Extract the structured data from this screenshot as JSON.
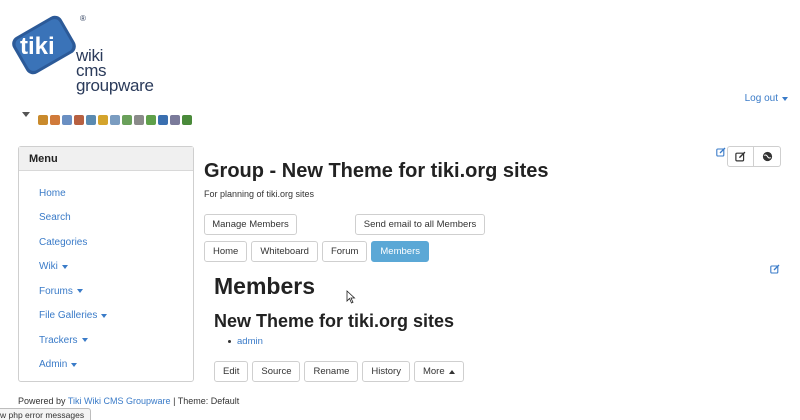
{
  "logo": {
    "badge_text": "tiki",
    "line1": "wiki",
    "line2": "cms",
    "line3": "groupware",
    "reg_mark": "®"
  },
  "header": {
    "logout_label": "Log out"
  },
  "toolbar_icons": [
    {
      "icon": "wrench-icon",
      "color": "#c98a2c"
    },
    {
      "icon": "home-icon",
      "color": "#d07a3a"
    },
    {
      "icon": "pencil-icon",
      "color": "#6a8fc2"
    },
    {
      "icon": "user-icon",
      "color": "#b76040"
    },
    {
      "icon": "users-icon",
      "color": "#5a8ab0"
    },
    {
      "icon": "key-icon",
      "color": "#d4a42c"
    },
    {
      "icon": "table-icon",
      "color": "#7a9cc0"
    },
    {
      "icon": "refresh-icon",
      "color": "#6aa05a"
    },
    {
      "icon": "module-icon",
      "color": "#8a8a8a"
    },
    {
      "icon": "puzzle-icon",
      "color": "#5fa04a"
    },
    {
      "icon": "book-icon",
      "color": "#3a6fb0"
    },
    {
      "icon": "card-icon",
      "color": "#7a7a9a"
    },
    {
      "icon": "leaf-icon",
      "color": "#4a8a3a"
    }
  ],
  "menu": {
    "heading": "Menu",
    "items": [
      {
        "label": "Home",
        "has_dropdown": false
      },
      {
        "label": "Search",
        "has_dropdown": false
      },
      {
        "label": "Categories",
        "has_dropdown": false
      },
      {
        "label": "Wiki",
        "has_dropdown": true
      },
      {
        "label": "Forums",
        "has_dropdown": true
      },
      {
        "label": "File Galleries",
        "has_dropdown": true
      },
      {
        "label": "Trackers",
        "has_dropdown": true
      },
      {
        "label": "Admin",
        "has_dropdown": true
      }
    ]
  },
  "main": {
    "title": "Group - New Theme for tiki.org sites",
    "description": "For planning of tiki.org sites",
    "manage_members_label": "Manage Members",
    "send_email_label": "Send email to all Members",
    "tabs": [
      {
        "label": "Home",
        "active": false
      },
      {
        "label": "Whiteboard",
        "active": false
      },
      {
        "label": "Forum",
        "active": false
      },
      {
        "label": "Members",
        "active": true
      }
    ],
    "members_heading": "Members",
    "group_heading": "New Theme for tiki.org sites",
    "members": [
      "admin"
    ],
    "actions": [
      {
        "label": "Edit"
      },
      {
        "label": "Source"
      },
      {
        "label": "Rename"
      },
      {
        "label": "History"
      },
      {
        "label": "More"
      }
    ]
  },
  "footer": {
    "powered_by": "Powered by",
    "link_text": "Tiki Wiki CMS Groupware",
    "theme_text": "| Theme: Default"
  },
  "status": {
    "text": "w php error messages"
  },
  "colors": {
    "accent": "#3a7bc8",
    "active_tab": "#5ba8d6",
    "logo_navy": "#2a3a5a"
  }
}
